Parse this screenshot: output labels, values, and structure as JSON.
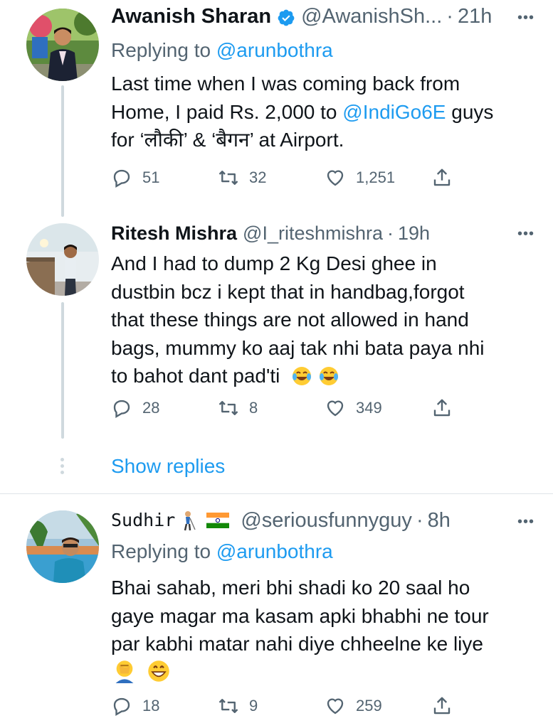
{
  "tweets": [
    {
      "name": "Awanish Sharan",
      "handle": "@AwanishSh...",
      "separator": "·",
      "time": "21h",
      "replying_prefix": "Replying to",
      "replying_to": "@arunbothra",
      "body_line1": "Last time when I was coming back from",
      "body_line2_pre": "Home, I paid Rs. 2,000 to",
      "body_mention": "@IndiGo6E",
      "body_line2_post": "guys",
      "body_line3": "for ‘लौकी’ & ‘बैगन’ at Airport.",
      "replies": "51",
      "retweets": "32",
      "likes": "1,251"
    },
    {
      "name": "Ritesh Mishra",
      "handle": "@I_riteshmishra",
      "separator": "·",
      "time": "19h",
      "body_line1": "And I had to dump 2 Kg Desi ghee in",
      "body_line2": "dustbin bcz i  kept that in handbag,forgot",
      "body_line3": "that these things are not allowed in hand",
      "body_line4": "bags, mummy ko aaj tak nhi bata paya nhi",
      "body_line5": "to bahot dant pad'ti",
      "replies": "28",
      "retweets": "8",
      "likes": "349"
    },
    {
      "name": "Sudhir",
      "handle": "@seriousfunnyguy",
      "separator": "·",
      "time": "8h",
      "replying_prefix": "Replying to",
      "replying_to": "@arunbothra",
      "body_line1": "Bhai sahab, meri bhi shadi ko 20 saal ho",
      "body_line2": "gaye magar ma kasam apki bhabhi ne tour",
      "body_line3": "par kabhi matar nahi diye chheelne ke liye",
      "replies": "18",
      "retweets": "9",
      "likes": "259"
    }
  ],
  "show_replies": "Show replies",
  "more_menu": "•••",
  "colors": {
    "accent": "#1d9bf0",
    "muted": "#536471",
    "text": "#0f1419",
    "line": "#cfd9de"
  },
  "icons": [
    "reply-icon",
    "retweet-icon",
    "like-icon",
    "share-icon",
    "verified-badge-icon",
    "more-icon"
  ]
}
